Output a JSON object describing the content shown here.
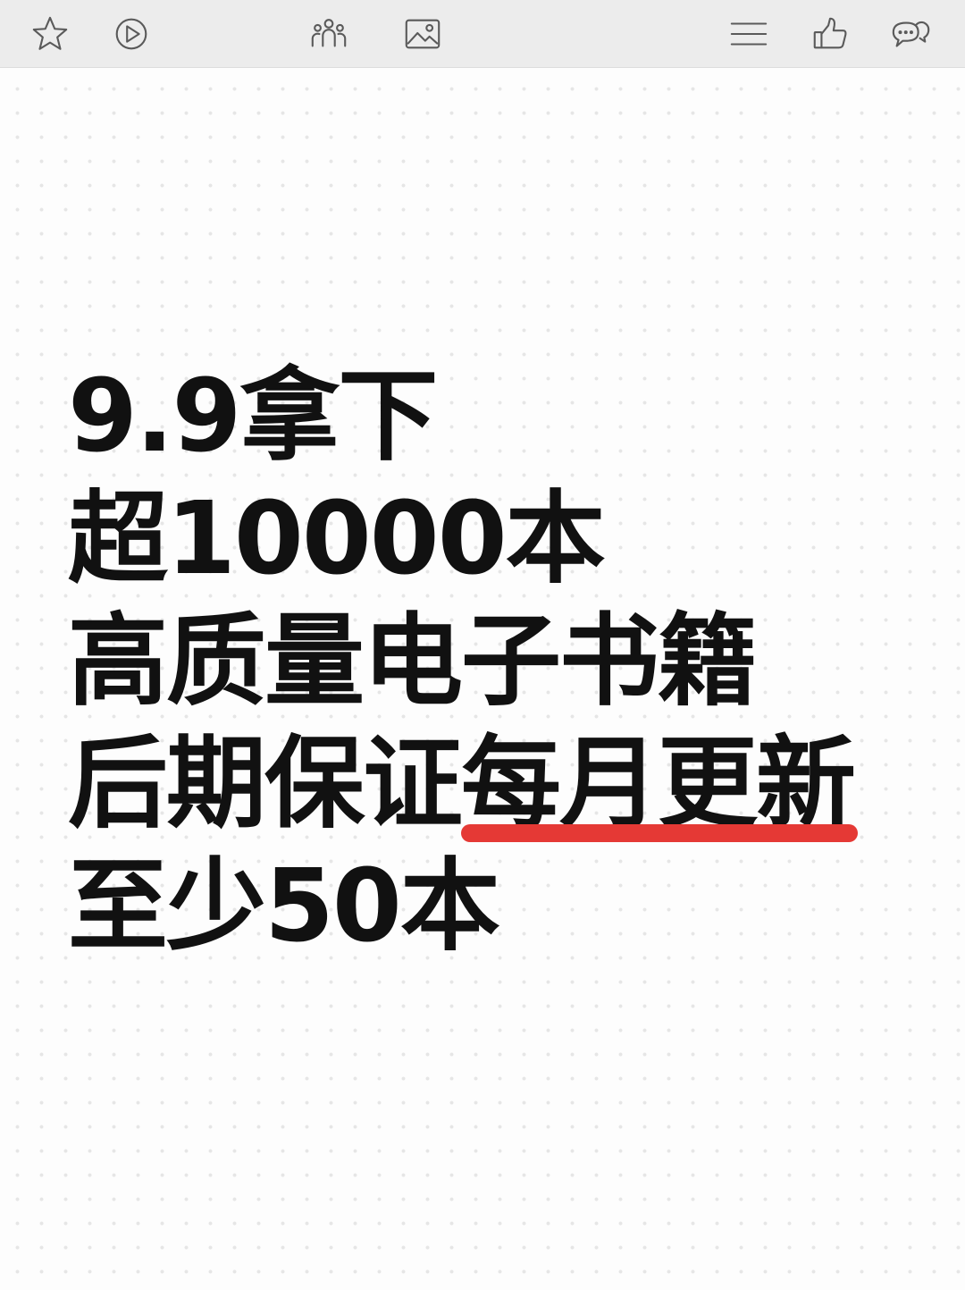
{
  "toolbar": {
    "left_icons": [
      "star-icon",
      "play-icon"
    ],
    "center_icons": [
      "people-icon",
      "image-icon"
    ],
    "right_icons": [
      "menu-icon",
      "thumbs-up-icon",
      "comments-icon"
    ],
    "icon_color": "#5a5a5a",
    "background": "#ececec"
  },
  "content": {
    "line1": "9.9拿下",
    "line2": "超10000本",
    "line3": "高质量电子书籍",
    "line4_plain": "后期保证",
    "line4_highlight": "每月更新",
    "line5": "至少50本",
    "text_color": "#111111",
    "highlight_color": "#e53935"
  }
}
